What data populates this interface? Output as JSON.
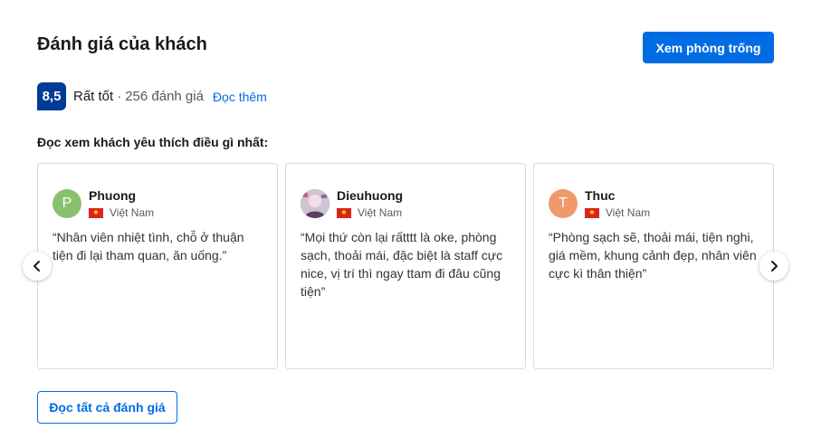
{
  "header": {
    "title": "Đánh giá của khách",
    "cta_label": "Xem phòng trống"
  },
  "score": {
    "value": "8,5",
    "rating": "Rất tốt",
    "separator": "·",
    "count": "256 đánh giá",
    "read_more": "Đọc thêm"
  },
  "subtitle": "Đọc xem khách yêu thích điều gì nhất:",
  "reviews": [
    {
      "avatar_letter": "P",
      "avatar_color": "#8bc16e",
      "name": "Phuong",
      "country": "Việt Nam",
      "quote": "“Nhân viên nhiệt tình, chỗ ở thuận tiện đi lại tham quan, ăn uống.”"
    },
    {
      "avatar_letter": "",
      "avatar_color": "#7a5b7d",
      "name": "Dieuhuong",
      "country": "Việt Nam",
      "quote": "“Mọi thứ còn lại rấtttt là oke, phòng sạch, thoải mái, đặc biệt là staff cực nice, vị trí thì ngay ttam đi đâu cũng tiện”"
    },
    {
      "avatar_letter": "T",
      "avatar_color": "#f0996b",
      "name": "Thuc",
      "country": "Việt Nam",
      "quote": "“Phòng sạch sẽ, thoải mái, tiện nghi, giá mềm, khung cảnh đẹp, nhân viên cực kì thân thiện”"
    }
  ],
  "footer": {
    "all_reviews_label": "Đọc tất cả đánh giá"
  },
  "colors": {
    "primary": "#006ce4",
    "score_badge": "#003b95"
  },
  "icons": {
    "prev": "chevron-left-icon",
    "next": "chevron-right-icon",
    "flag": "vietnam-flag-icon"
  }
}
